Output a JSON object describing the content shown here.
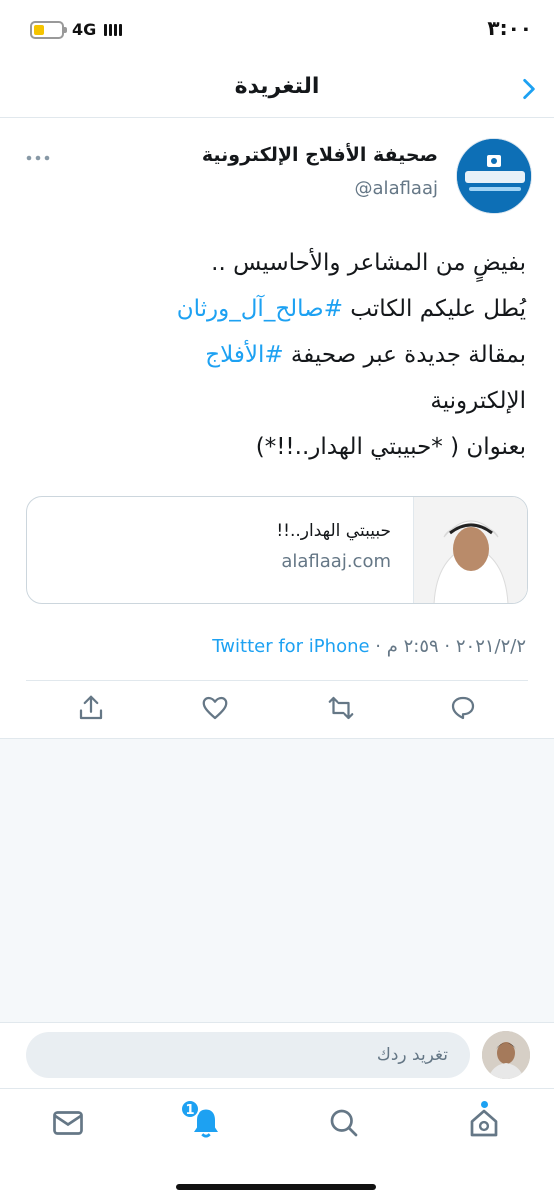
{
  "status_bar": {
    "time": "٣:٠٠",
    "network": "4G",
    "battery_level": 0.4,
    "colors": {
      "battery": "#f5c400"
    }
  },
  "header": {
    "title": "التغريدة",
    "back_icon": "chevron-right-icon"
  },
  "tweet": {
    "author": {
      "name": "صحيفة الأفلاج الإلكترونية",
      "handle": "@alaflaaj"
    },
    "body": {
      "line1": "بفيضٍ من المشاعر والأحاسيس ..",
      "line2_prefix": "يُطل عليكم الكاتب ",
      "line2_hashtag": "#صالح_آل_ورثان",
      "line3_prefix": "بمقالة جديدة عبر صحيفة ",
      "line3_hashtag": "#الأفلاج",
      "line4": "الإلكترونية",
      "line5": "بعنوان ( *حبيبتي الهدار..!!*)"
    },
    "link_card": {
      "title": "حبيبتي الهدار..!!",
      "domain": "alaflaaj.com"
    },
    "meta": {
      "date": "٢٠٢١/٢/٢",
      "time": "٢:٥٩ م",
      "separator": " · ",
      "source": "Twitter for iPhone"
    },
    "actions": [
      "reply-icon",
      "retweet-icon",
      "like-icon",
      "share-icon"
    ]
  },
  "reply": {
    "placeholder": "تغريد ردك"
  },
  "tab_bar": {
    "notifications_badge": "1",
    "tabs": [
      "home-icon",
      "search-icon",
      "notifications-icon",
      "messages-icon"
    ]
  },
  "colors": {
    "accent": "#1da1f2",
    "text": "#14171a",
    "secondary": "#657786",
    "border": "#e1e8ed"
  }
}
